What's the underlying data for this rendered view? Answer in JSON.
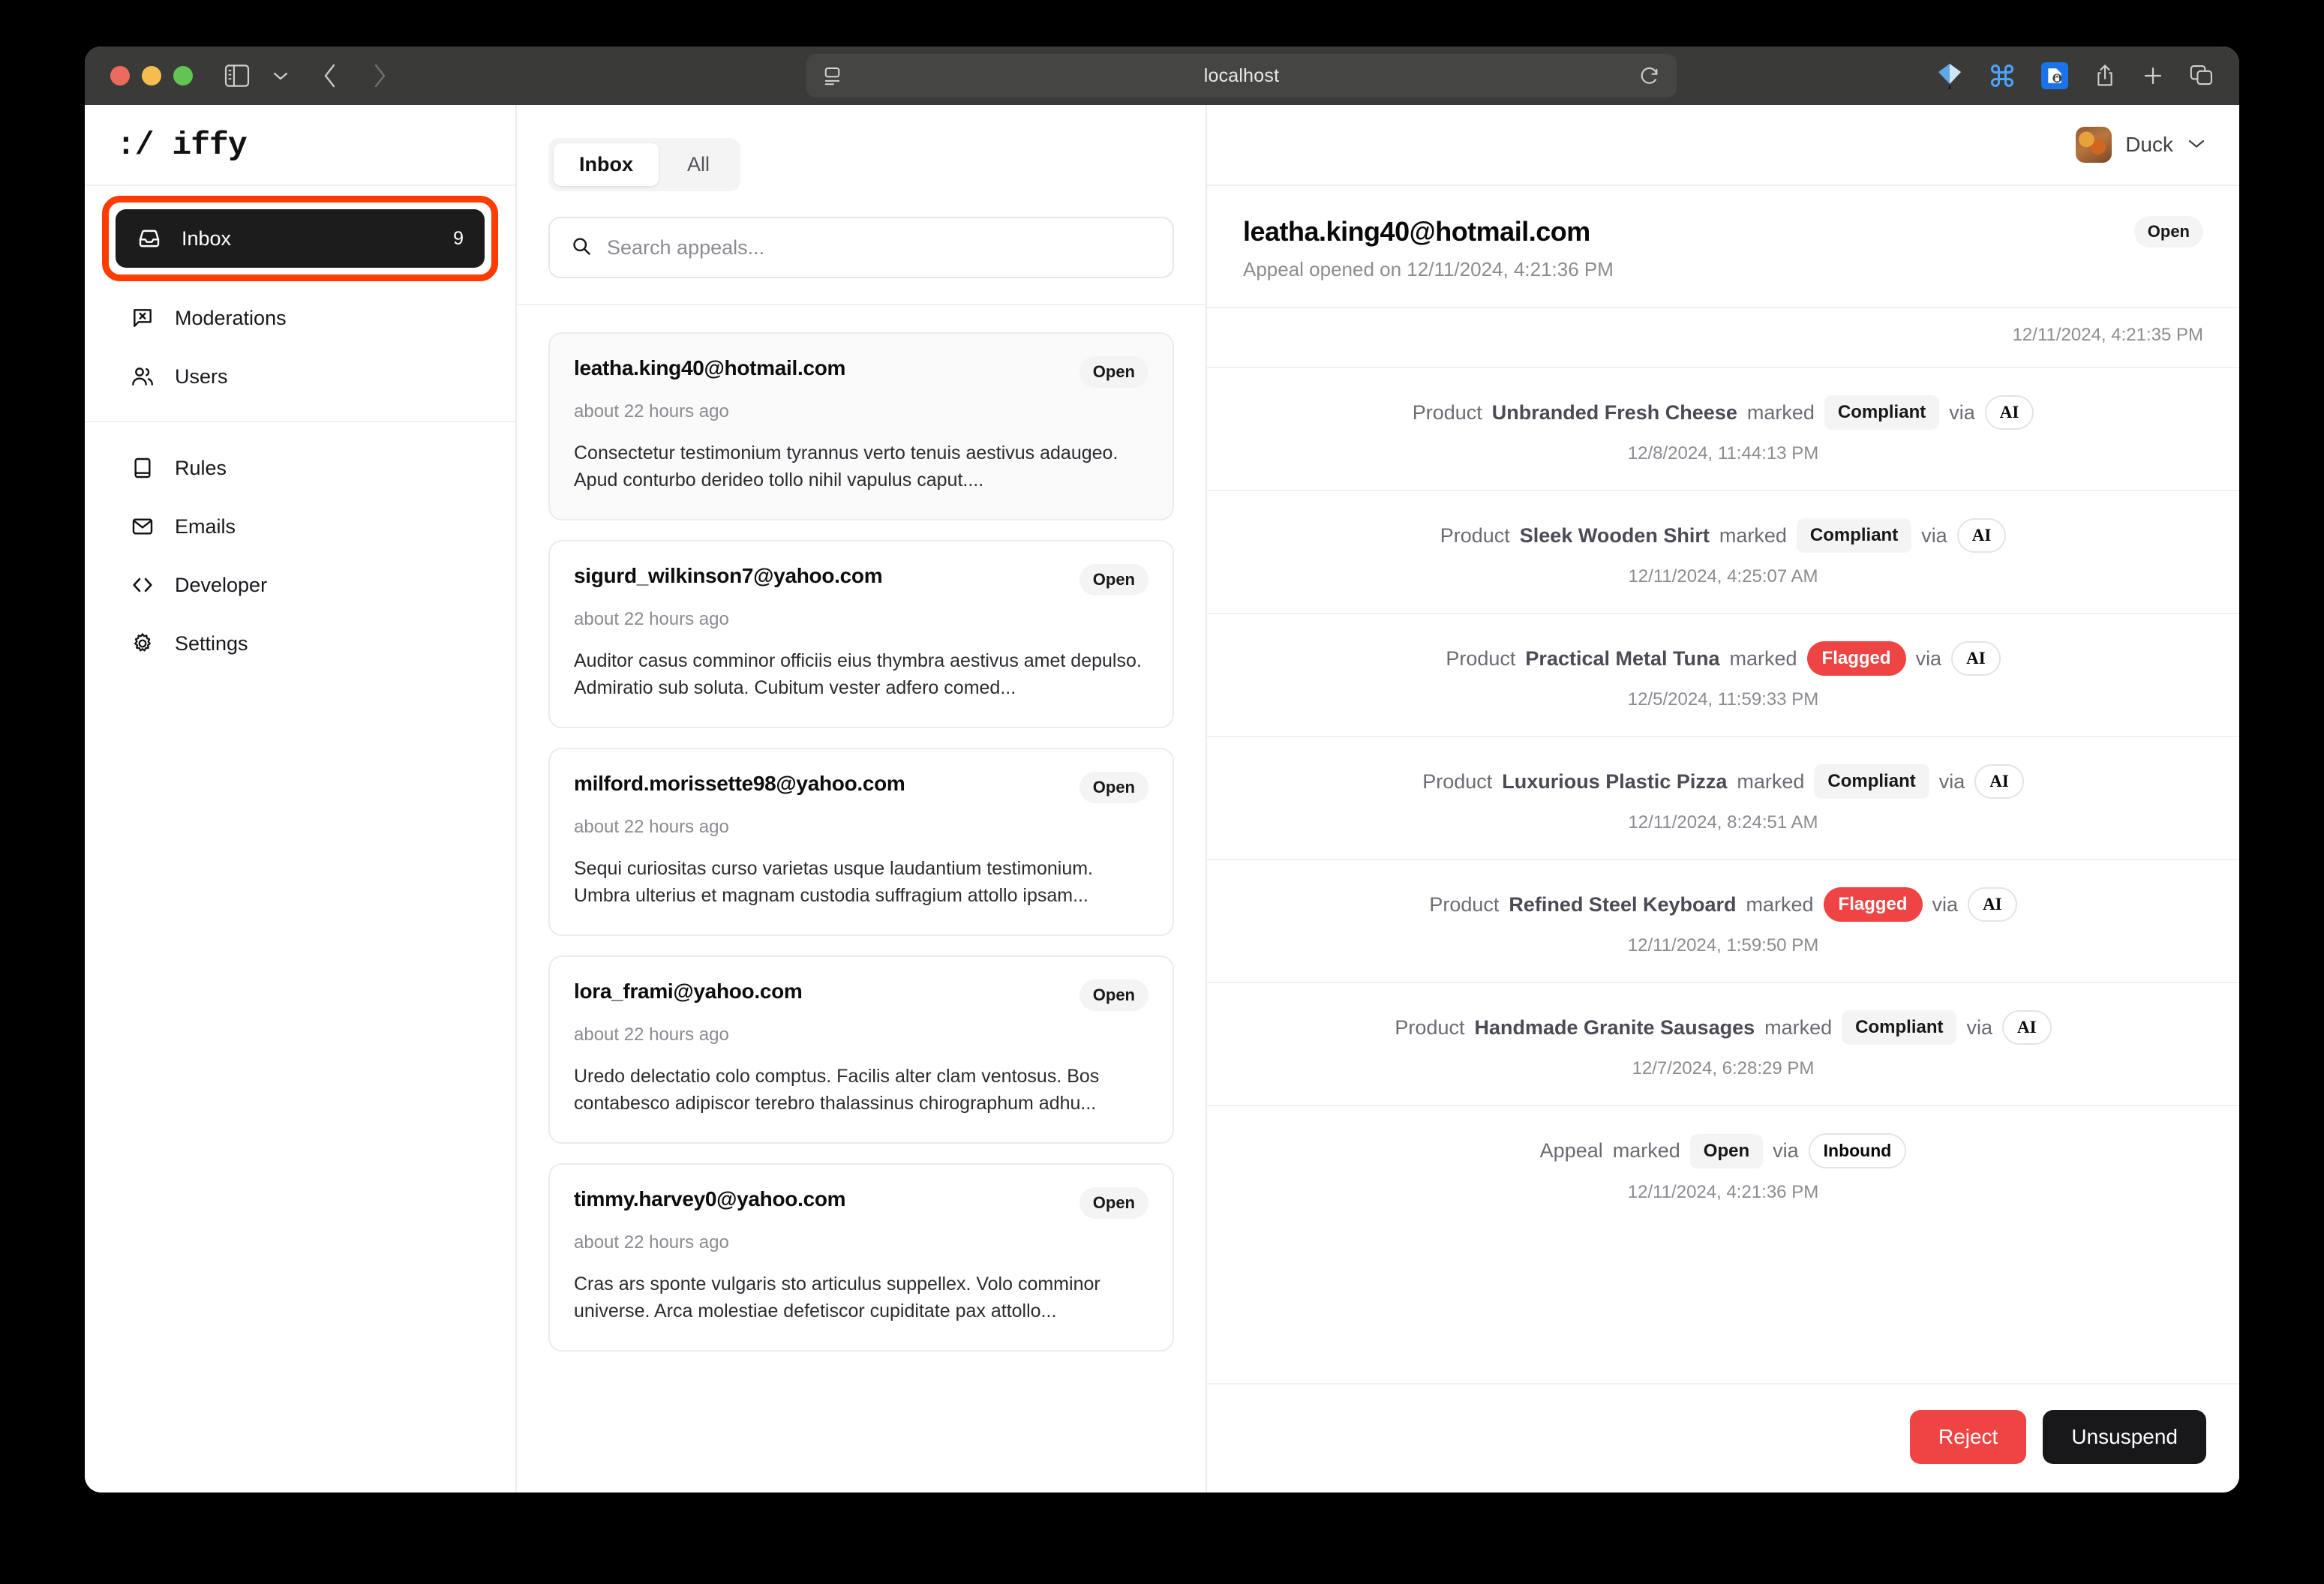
{
  "browser": {
    "url_text": "localhost",
    "controls": {
      "close": "close-window",
      "minimize": "minimize-window",
      "maximize": "maximize-window"
    }
  },
  "sidebar": {
    "brand": ":/ iffy",
    "groups": [
      {
        "items": [
          {
            "label": "Inbox",
            "icon": "inbox-icon",
            "count": "9",
            "active": true
          },
          {
            "label": "Moderations",
            "icon": "moderation-icon",
            "count": "",
            "active": false
          },
          {
            "label": "Users",
            "icon": "users-icon",
            "count": "",
            "active": false
          }
        ]
      },
      {
        "items": [
          {
            "label": "Rules",
            "icon": "book-icon",
            "count": "",
            "active": false
          },
          {
            "label": "Emails",
            "icon": "envelope-icon",
            "count": "",
            "active": false
          },
          {
            "label": "Developer",
            "icon": "code-icon",
            "count": "",
            "active": false
          },
          {
            "label": "Settings",
            "icon": "gear-icon",
            "count": "",
            "active": false
          }
        ]
      }
    ]
  },
  "list": {
    "tabs": [
      {
        "label": "Inbox",
        "active": true
      },
      {
        "label": "All",
        "active": false
      }
    ],
    "search": {
      "placeholder": "Search appeals...",
      "value": ""
    },
    "cards": [
      {
        "email": "leatha.king40@hotmail.com",
        "status": "Open",
        "time": "about 22 hours ago",
        "excerpt": "Consectetur testimonium tyrannus verto tenuis aestivus adaugeo. Apud conturbo derideo tollo nihil vapulus caput....",
        "selected": true
      },
      {
        "email": "sigurd_wilkinson7@yahoo.com",
        "status": "Open",
        "time": "about 22 hours ago",
        "excerpt": "Auditor casus comminor officiis eius thymbra aestivus amet depulso. Admiratio sub soluta. Cubitum vester adfero comed...",
        "selected": false
      },
      {
        "email": "milford.morissette98@yahoo.com",
        "status": "Open",
        "time": "about 22 hours ago",
        "excerpt": "Sequi curiositas curso varietas usque laudantium testimonium. Umbra ulterius et magnam custodia suffragium attollo ipsam...",
        "selected": false
      },
      {
        "email": "lora_frami@yahoo.com",
        "status": "Open",
        "time": "about 22 hours ago",
        "excerpt": "Uredo delectatio colo comptus. Facilis alter clam ventosus. Bos contabesco adipiscor terebro thalassinus chirographum adhu...",
        "selected": false
      },
      {
        "email": "timmy.harvey0@yahoo.com",
        "status": "Open",
        "time": "about 22 hours ago",
        "excerpt": "Cras ars sponte vulgaris sto articulus suppellex. Volo comminor universe. Arca molestiae defetiscor cupiditate pax attollo...",
        "selected": false
      }
    ]
  },
  "topbar": {
    "user_name": "Duck",
    "chevron": "chevron-down-icon"
  },
  "detail": {
    "email": "leatha.king40@hotmail.com",
    "status": "Open",
    "subtitle": "Appeal opened on 12/11/2024, 4:21:36 PM",
    "first_timestamp": "12/11/2024, 4:21:35 PM",
    "events": [
      {
        "prefix": "Product",
        "subject": "Unbranded Fresh Cheese",
        "verb": "marked",
        "status": "Compliant",
        "status_kind": "gray",
        "via_label": "via",
        "via": "AI",
        "time": "12/8/2024, 11:44:13 PM"
      },
      {
        "prefix": "Product",
        "subject": "Sleek Wooden Shirt",
        "verb": "marked",
        "status": "Compliant",
        "status_kind": "gray",
        "via_label": "via",
        "via": "AI",
        "time": "12/11/2024, 4:25:07 AM"
      },
      {
        "prefix": "Product",
        "subject": "Practical Metal Tuna",
        "verb": "marked",
        "status": "Flagged",
        "status_kind": "red",
        "via_label": "via",
        "via": "AI",
        "time": "12/5/2024, 11:59:33 PM"
      },
      {
        "prefix": "Product",
        "subject": "Luxurious Plastic Pizza",
        "verb": "marked",
        "status": "Compliant",
        "status_kind": "gray",
        "via_label": "via",
        "via": "AI",
        "time": "12/11/2024, 8:24:51 AM"
      },
      {
        "prefix": "Product",
        "subject": "Refined Steel Keyboard",
        "verb": "marked",
        "status": "Flagged",
        "status_kind": "red",
        "via_label": "via",
        "via": "AI",
        "time": "12/11/2024, 1:59:50 PM"
      },
      {
        "prefix": "Product",
        "subject": "Handmade Granite Sausages",
        "verb": "marked",
        "status": "Compliant",
        "status_kind": "gray",
        "via_label": "via",
        "via": "AI",
        "time": "12/7/2024, 6:28:29 PM"
      },
      {
        "prefix": "Appeal",
        "subject": "",
        "verb": "marked",
        "status": "Open",
        "status_kind": "gray",
        "via_label": "via",
        "via": "Inbound",
        "time": "12/11/2024, 4:21:36 PM"
      }
    ],
    "actions": {
      "reject": "Reject",
      "unsuspend": "Unsuspend"
    }
  },
  "colors": {
    "accent_red": "#ef4444",
    "highlight_ring": "#fe3b00",
    "dark": "#18181b"
  }
}
